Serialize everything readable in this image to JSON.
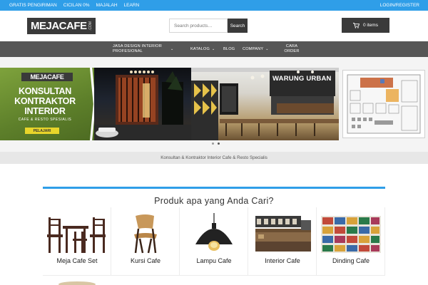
{
  "topbar": {
    "links": [
      "GRATIS PENGIRIMAN",
      "CICILAN 0%",
      "MAJALAH",
      "LEARN"
    ],
    "login": "LOGIN/REGISTER"
  },
  "header": {
    "logo_text": "MEJACAFE",
    "logo_suffix": ".COM",
    "search_placeholder": "Search products…",
    "search_button": "Search",
    "cart_label": "0 items"
  },
  "nav": {
    "items": [
      {
        "label": "JASA DESIGN INTERIOR PROFESIONAL",
        "has_dropdown": true
      },
      {
        "label": "KATALOG",
        "has_dropdown": true
      },
      {
        "label": "BLOG",
        "has_dropdown": false
      },
      {
        "label": "COMPANY",
        "has_dropdown": true
      },
      {
        "label": "CARA ORDER",
        "has_dropdown": false
      }
    ]
  },
  "banner": {
    "promo_logo": "MEJACAFE",
    "promo_heading": "KONSULTAN KONTRAKTOR INTERIOR",
    "promo_sub": "CAFE & RESTO SPESIALIS",
    "promo_button": "PELAJARI",
    "sign_text": "WARUNG URBAN",
    "slider_dots": 2,
    "active_dot": 1
  },
  "caption": "Konsultan & Kontraktor Interior Cafe & Resto Specialis",
  "products": {
    "title": "Produk apa yang Anda Cari?",
    "items": [
      {
        "label": "Meja Cafe Set",
        "icon": "cafe-table-set-icon"
      },
      {
        "label": "Kursi Cafe",
        "icon": "cafe-chair-icon"
      },
      {
        "label": "Lampu Cafe",
        "icon": "pendant-lamp-icon"
      },
      {
        "label": "Interior Cafe",
        "icon": "cafe-interior-icon"
      },
      {
        "label": "Dinding Cafe",
        "icon": "wall-decor-icon"
      }
    ]
  },
  "colors": {
    "accent_blue": "#2f9ee8",
    "dark": "#3a3a3a",
    "nav_bg": "#565656",
    "promo_green": "#6a8f2e",
    "promo_button": "#e8d52a"
  }
}
